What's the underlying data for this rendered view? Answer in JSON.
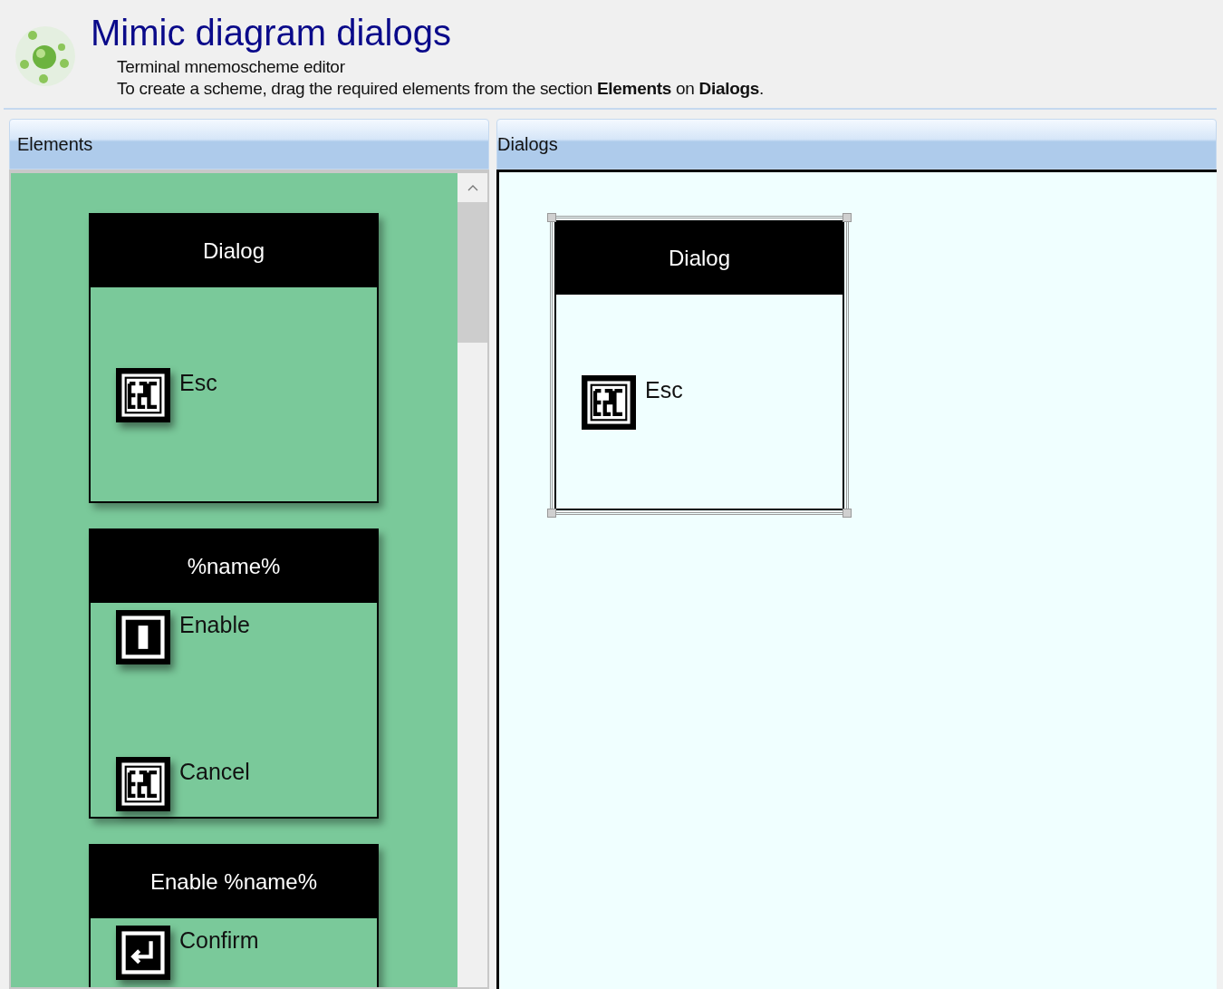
{
  "header": {
    "title": "Mimic diagram dialogs",
    "subtitle": "Terminal mnemoscheme editor",
    "hint": "To create a scheme, drag the required elements from the section **Elements** on **Dialogs**."
  },
  "elements_panel": {
    "title": "Elements",
    "cards": [
      {
        "title": "Dialog",
        "selected": false,
        "items": [
          {
            "kind": "escape",
            "label": "Esc"
          }
        ]
      },
      {
        "title": "%name%",
        "selected": false,
        "items": [
          {
            "kind": "enable",
            "label": "Enable"
          },
          {
            "kind": "escape",
            "label": "Cancel"
          }
        ]
      },
      {
        "title": "Enable %name%",
        "selected": false,
        "items": [
          {
            "kind": "enter",
            "label": "Confirm"
          }
        ]
      }
    ]
  },
  "dialogs_panel": {
    "title": "Dialogs",
    "cards": [
      {
        "title": "Dialog",
        "selected": true,
        "items": [
          {
            "kind": "escape",
            "label": "Esc"
          }
        ]
      }
    ]
  }
}
